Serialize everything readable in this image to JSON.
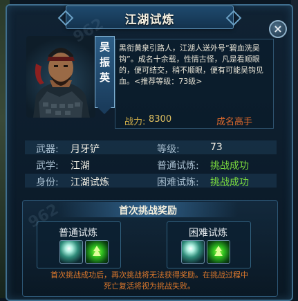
{
  "window": {
    "title": "江湖试炼",
    "close_label": "×"
  },
  "npc": {
    "name_chars": [
      "吴",
      "振",
      "英"
    ],
    "description": "黑衔黄泉引路人，江湖人送外号“碧血洗吴钩”。成名十余载，性情古怪，凡是看顺眼的，便可结交，稍不顺眼，便有可能吴钩见血。<推荐等级：73级>",
    "power_label": "战力:",
    "power_value": "8300",
    "rank": "成名高手"
  },
  "info": {
    "weapon_label": "武器:",
    "weapon_value": "月牙铲",
    "level_label": "等级:",
    "level_value": "73",
    "skill_label": "武学:",
    "skill_value": "江湖",
    "normal_label": "普通试炼:",
    "normal_value": "挑战成功",
    "identity_label": "身份:",
    "identity_value": "江湖试炼",
    "hard_label": "困难试炼:",
    "hard_value": "挑战成功"
  },
  "rewards": {
    "title": "首次挑战奖励",
    "normal_title": "普通试炼",
    "hard_title": "困难试炼",
    "items": [
      "orb-item-icon",
      "leaf-item-icon"
    ],
    "notice_line1": "首次挑战成功后，再次挑战将无法获得奖励。在挑战过程中",
    "notice_line2": "死亡复活将视为挑战失败。"
  },
  "colors": {
    "success": "#7bdc3e",
    "rank": "#e06a2c",
    "power": "#e0c060",
    "notice": "#e07a2c"
  },
  "watermark": "962"
}
